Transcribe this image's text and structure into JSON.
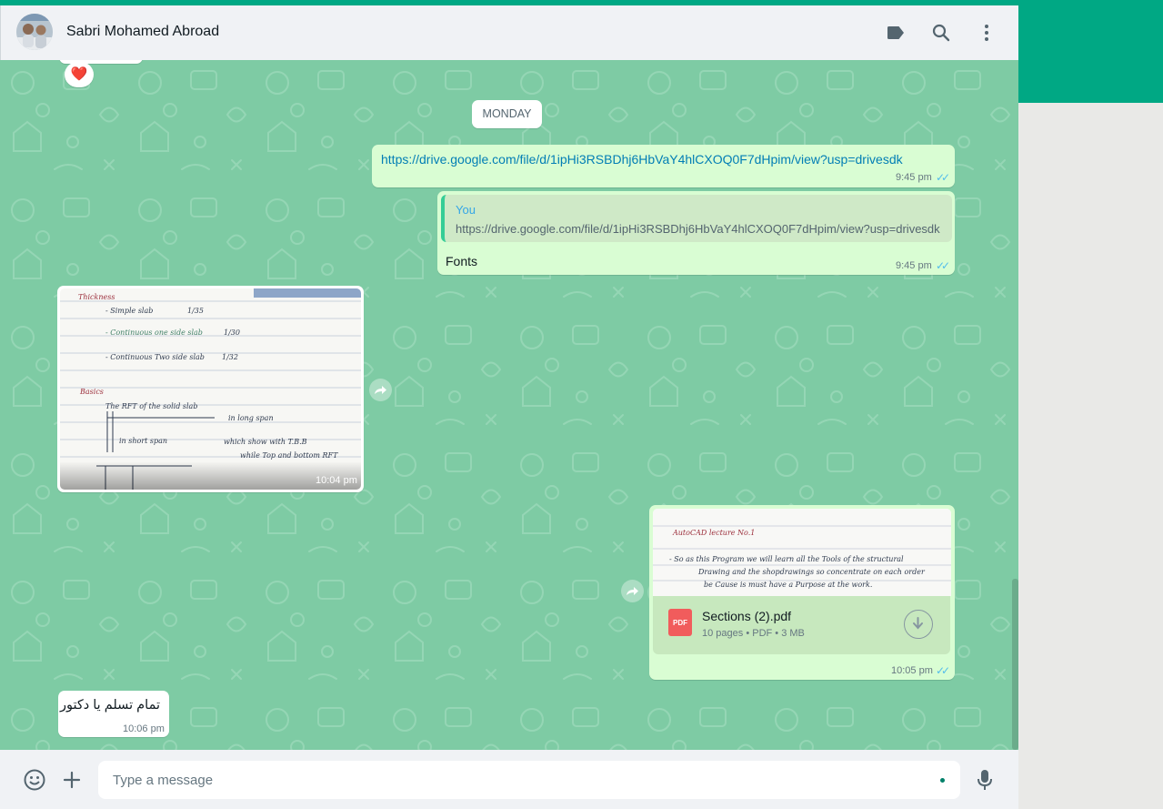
{
  "header": {
    "contact_name": "Sabri Mohamed Abroad"
  },
  "reaction": {
    "emoji": "❤️"
  },
  "day_separator": "MONDAY",
  "messages": [
    {
      "type": "link",
      "text": "https://drive.google.com/file/d/1ipHi3RSBDhj6HbVaY4hlCXOQ0F7dHpim/view?usp=drivesdk",
      "time": "9:45 pm"
    },
    {
      "type": "reply",
      "quote_author": "You",
      "quote_text": "https://drive.google.com/file/d/1ipHi3RSBDhj6HbVaY4hlCXOQ0F7dHpim/view?usp=drivesdk",
      "text": "Fonts",
      "time": "9:45 pm"
    },
    {
      "type": "image",
      "time": "10:04 pm",
      "notes": [
        "Thickness",
        "- Simple slab",
        "- Continuous one side slab",
        "- Continuous Two side slab",
        "Basics",
        "The RFT of the solid slab",
        "in long span",
        "in short span",
        "which show with T.B.B",
        "while Top and bottom RFT",
        "1/35",
        "1/30",
        "1/32"
      ]
    },
    {
      "type": "document",
      "preview_lines": [
        "AutoCAD lecture No.1",
        "- So as this Program we will learn all the Tools of the structural",
        "Drawing and the shopdrawings so concentrate on each order",
        "be Cause is must have a Purpose at the work."
      ],
      "file_name": "Sections (2).pdf",
      "file_type": "PDF",
      "file_meta": "10 pages • PDF • 3 MB",
      "time": "10:05 pm"
    },
    {
      "type": "text",
      "text": "تمام تسلم يا دكتور",
      "time": "10:06 pm"
    }
  ],
  "composer": {
    "placeholder": "Type a message"
  },
  "colors": {
    "accent": "#00a884",
    "wallpaper": "#7ecba4",
    "outgoing_bubble": "#d9fdd3",
    "read_ticks": "#53bdeb"
  }
}
